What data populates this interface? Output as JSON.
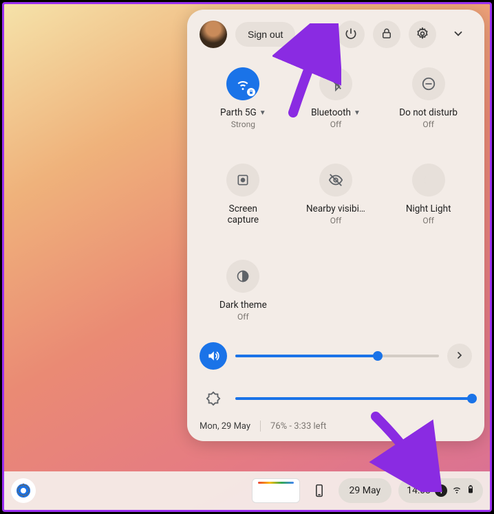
{
  "header": {
    "signout_label": "Sign out"
  },
  "tiles": {
    "wifi": {
      "label": "Parth 5G",
      "sub": "Strong",
      "has_caret": true
    },
    "bluetooth": {
      "label": "Bluetooth",
      "sub": "Off",
      "has_caret": true
    },
    "dnd": {
      "label": "Do not disturb",
      "sub": "Off"
    },
    "screencap": {
      "label": "Screen capture",
      "sub": ""
    },
    "nearby": {
      "label": "Nearby visibi…",
      "sub": "Off"
    },
    "nightlight": {
      "label": "Night Light",
      "sub": "Off"
    },
    "darktheme": {
      "label": "Dark theme",
      "sub": "Off"
    }
  },
  "sliders": {
    "volume_pct": 70,
    "brightness_pct": 100
  },
  "footer": {
    "date": "Mon, 29 May",
    "battery": "76% - 3:33 left"
  },
  "shelf": {
    "date": "29 May",
    "time": "14:03",
    "notif_count": "1"
  },
  "colors": {
    "accent": "#1a73e8",
    "panel_bg": "#f3ece7",
    "button_bg": "#e7e0da"
  }
}
